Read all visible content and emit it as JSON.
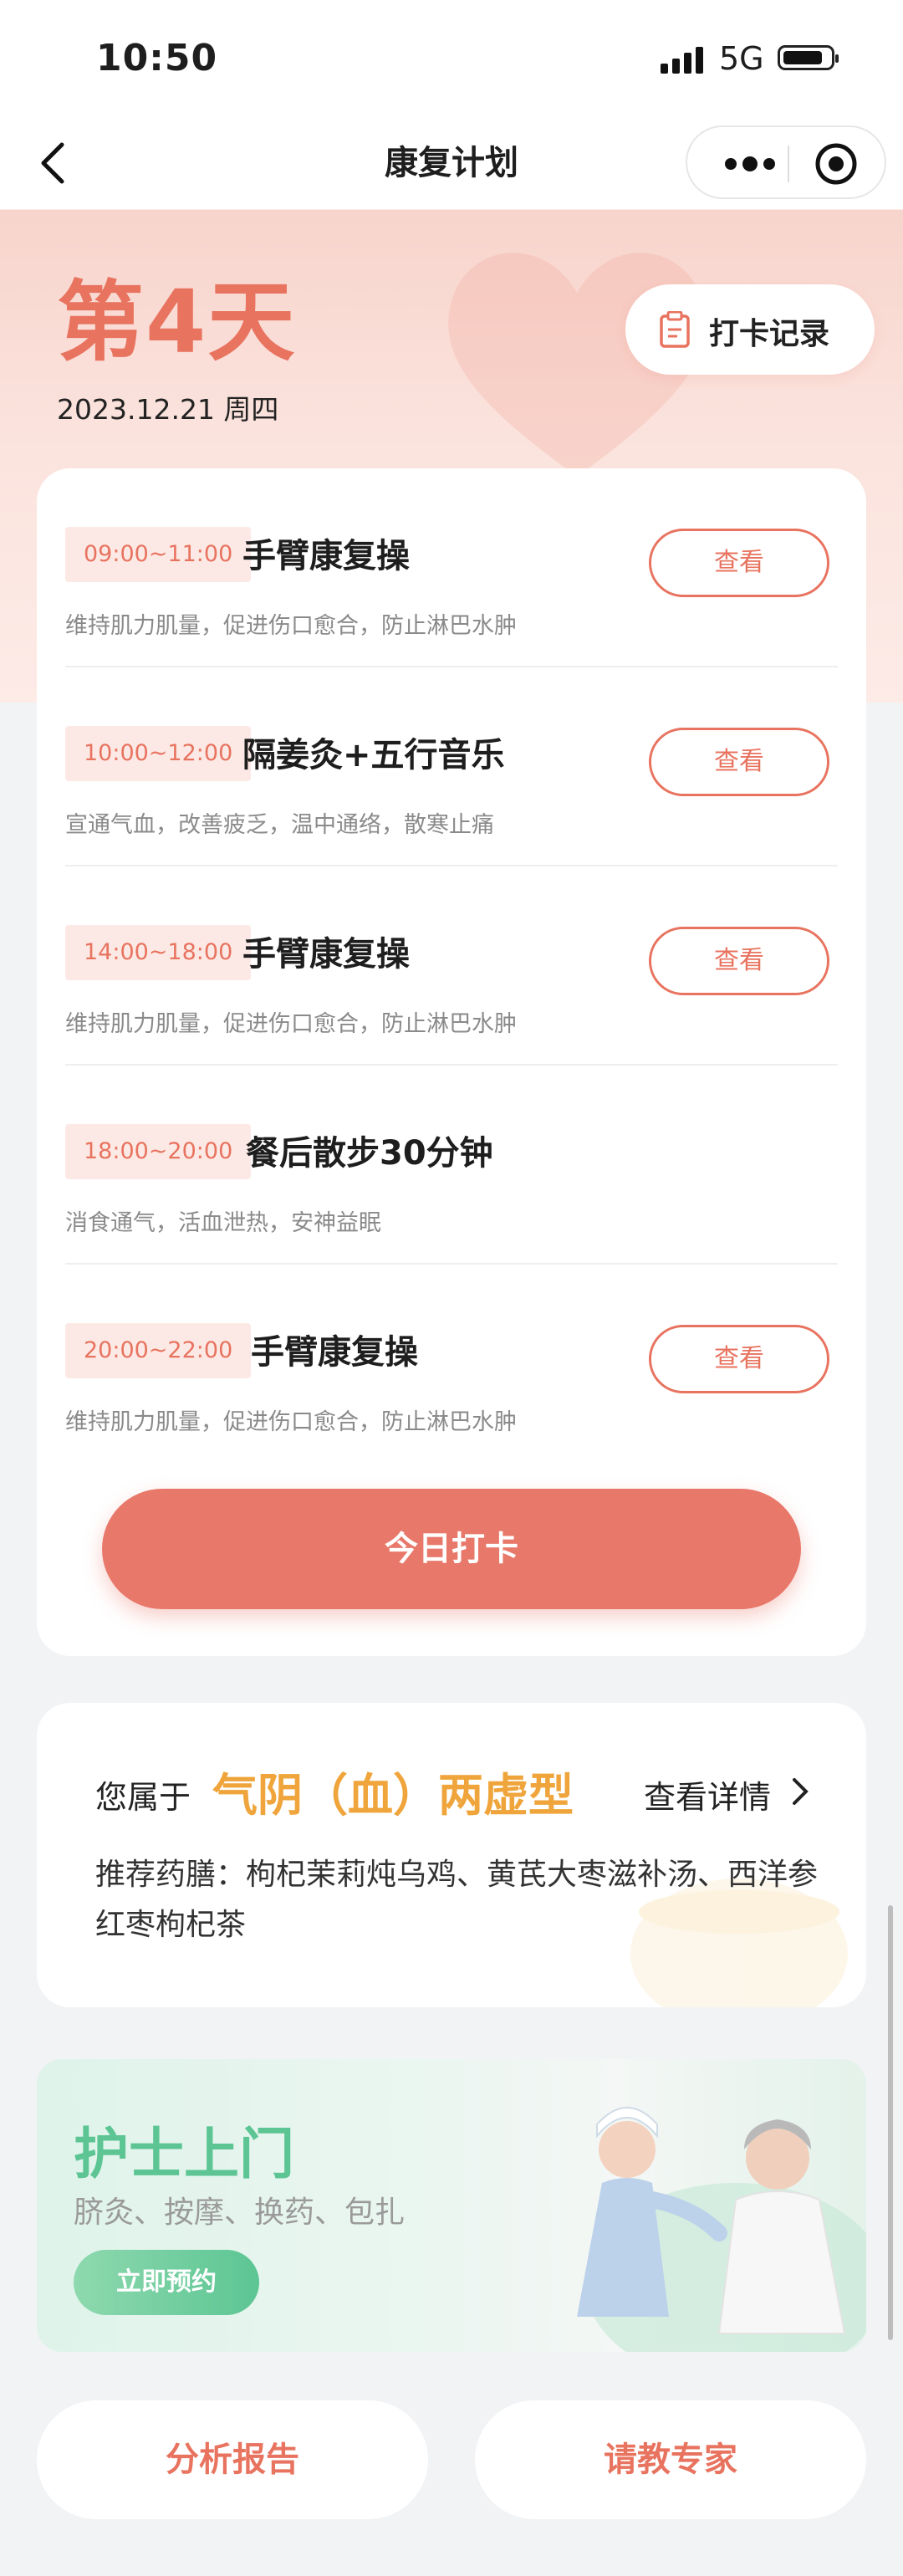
{
  "status_bar": {
    "time": "10:50",
    "network": "5G"
  },
  "nav": {
    "title": "康复计划"
  },
  "hero": {
    "day": "第4天",
    "date": "2023.12.21 周四",
    "checkin_record_label": "打卡记录"
  },
  "schedule": {
    "items": [
      {
        "time": "09:00~11:00",
        "title": "手臂康复操",
        "desc": "维持肌力肌量，促进伤口愈合，防止淋巴水肿",
        "action": "查看"
      },
      {
        "time": "10:00~12:00",
        "title": "隔姜灸+五行音乐",
        "desc": "宣通气血，改善疲乏，温中通络，散寒止痛",
        "action": "查看"
      },
      {
        "time": "14:00~18:00",
        "title": "手臂康复操",
        "desc": "维持肌力肌量，促进伤口愈合，防止淋巴水肿",
        "action": "查看"
      },
      {
        "time": "18:00~20:00",
        "title": "餐后散步30分钟",
        "desc": "消食通气，活血泄热，安神益眠",
        "action": ""
      },
      {
        "time": "20:00~22:00",
        "title": "手臂康复操",
        "desc": "维持肌力肌量，促进伤口愈合，防止淋巴水肿",
        "action": "查看"
      }
    ],
    "checkin_button": "今日打卡"
  },
  "constitution": {
    "prefix": "您属于",
    "type": "气阴（血）两虚型",
    "detail_link": "查看详情",
    "recommendation": "推荐药膳：枸杞茉莉炖乌鸡、黄芪大枣滋补汤、西洋参红枣枸杞茶"
  },
  "nurse_banner": {
    "title": "护士上门",
    "subtitle": "脐灸、按摩、换药、包扎",
    "button": "立即预约"
  },
  "bottom_actions": {
    "report": "分析报告",
    "expert": "请教专家"
  },
  "colors": {
    "accent": "#e8735f",
    "gold": "#efa53c",
    "green": "#5cc593"
  }
}
